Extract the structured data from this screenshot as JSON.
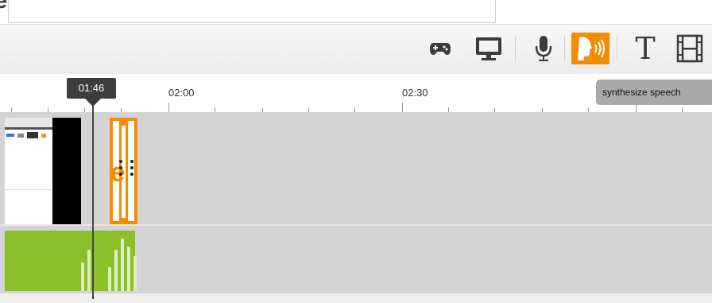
{
  "header": {
    "title_fragment": "é"
  },
  "toolbar": {
    "tools": [
      {
        "icon": "gamepad-icon"
      },
      {
        "icon": "monitor-icon"
      },
      {
        "icon": "microphone-icon"
      },
      {
        "icon": "synthesize-speech-icon",
        "active": true
      },
      {
        "icon": "text-icon",
        "glyph": "T"
      },
      {
        "icon": "film-icon"
      }
    ],
    "active_color": "#f28c00"
  },
  "tooltip": {
    "text": "synthesize speech"
  },
  "timeline": {
    "ticks": [
      "02:00",
      "02:30"
    ],
    "playhead": {
      "time": "01:46"
    },
    "track_color": "#d3d3d3",
    "audio_color": "#8abf2a"
  }
}
